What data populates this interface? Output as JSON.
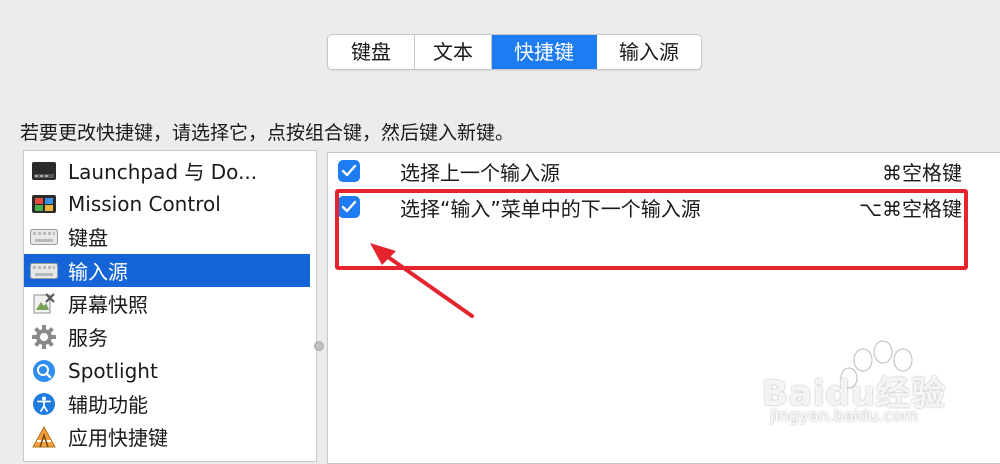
{
  "tabs": [
    {
      "label": "键盘"
    },
    {
      "label": "文本"
    },
    {
      "label": "快捷键"
    },
    {
      "label": "输入源"
    }
  ],
  "active_tab": "快捷键",
  "instruction": "若要更改快捷键，请选择它，点按组合键，然后键入新键。",
  "categories": [
    {
      "label": "Launchpad 与 Do...",
      "icon": "launchpad-icon"
    },
    {
      "label": "Mission Control",
      "icon": "mission-control-icon"
    },
    {
      "label": "键盘",
      "icon": "keyboard-icon"
    },
    {
      "label": "输入源",
      "icon": "keyboard-icon",
      "selected": true
    },
    {
      "label": "屏幕快照",
      "icon": "screenshot-icon"
    },
    {
      "label": "服务",
      "icon": "gear-icon"
    },
    {
      "label": "Spotlight",
      "icon": "spotlight-icon"
    },
    {
      "label": "辅助功能",
      "icon": "accessibility-icon"
    },
    {
      "label": "应用快捷键",
      "icon": "app-shortcuts-icon"
    }
  ],
  "shortcuts": [
    {
      "label": "选择上一个输入源",
      "key": "⌘空格键",
      "checked": true
    },
    {
      "label": "选择“输入”菜单中的下一个输入源",
      "key": "⌥⌘空格键",
      "checked": true
    }
  ],
  "watermark": {
    "brand": "Baidu经验",
    "url": "jingyan.baidu.com"
  },
  "colors": {
    "accent": "#1d7cf2",
    "selection": "#1565d8",
    "annotation": "#e5242d"
  }
}
